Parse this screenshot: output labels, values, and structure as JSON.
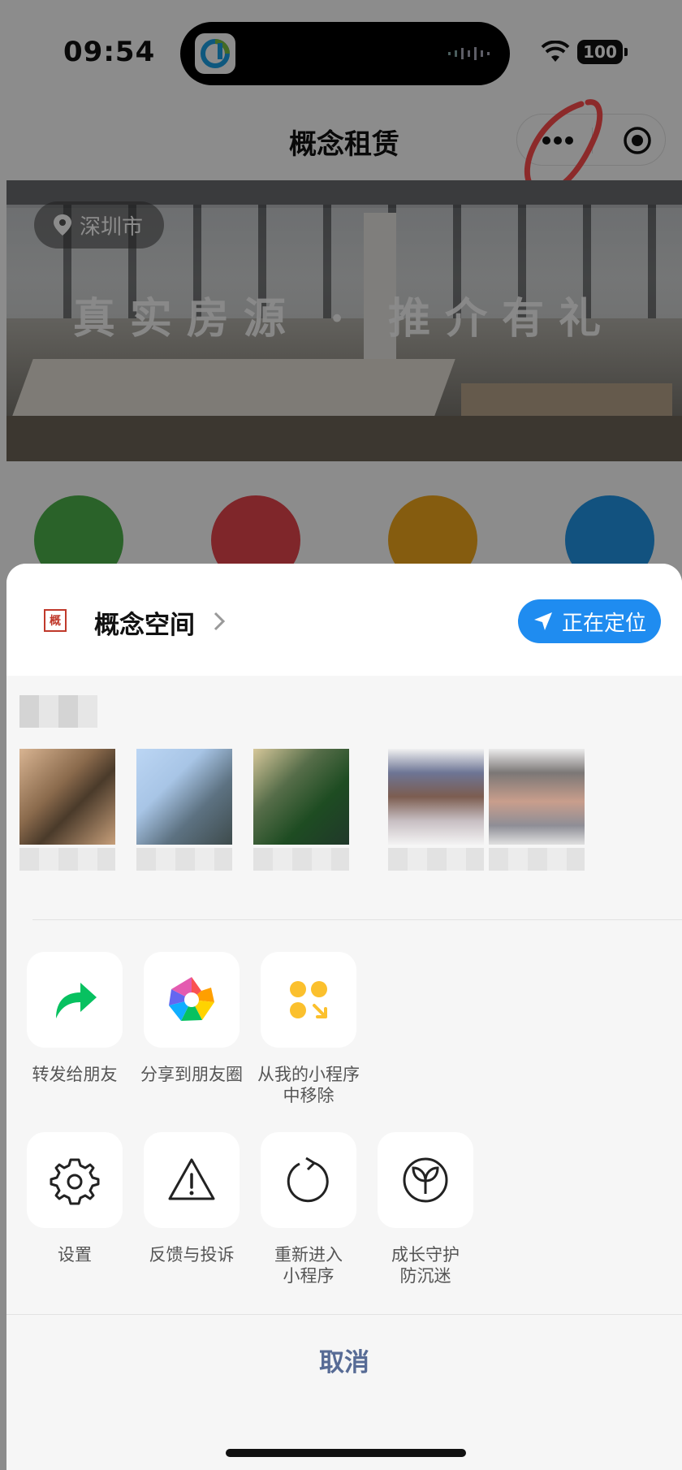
{
  "status_bar": {
    "time": "09:54",
    "battery": "100"
  },
  "nav": {
    "title": "概念租赁"
  },
  "banner": {
    "city": "深圳市",
    "slogan": "真实房源 · 推介有礼"
  },
  "sheet": {
    "app_name": "概念空间",
    "locate_button": "正在定位",
    "actions_row1": [
      {
        "label": "转发给朋友"
      },
      {
        "label": "分享到朋友圈"
      },
      {
        "label": "从我的小程序\n中移除"
      }
    ],
    "actions_row2": [
      {
        "label": "设置"
      },
      {
        "label": "反馈与投诉"
      },
      {
        "label": "重新进入\n小程序"
      },
      {
        "label": "成长守护\n防沉迷"
      }
    ],
    "cancel": "取消"
  },
  "colors": {
    "accent_blue": "#1f8cf0",
    "cancel_text": "#576b95",
    "share_green": "#07c160",
    "remove_yellow": "#fbc02d",
    "annotation_red": "#ff4d4d"
  },
  "icons": {
    "forward": "forward-arrow-icon",
    "moments": "moments-aperture-icon",
    "remove": "remove-miniprogram-icon",
    "settings": "gear-icon",
    "feedback": "warning-triangle-icon",
    "reenter": "refresh-icon",
    "guardian": "sprout-icon"
  }
}
